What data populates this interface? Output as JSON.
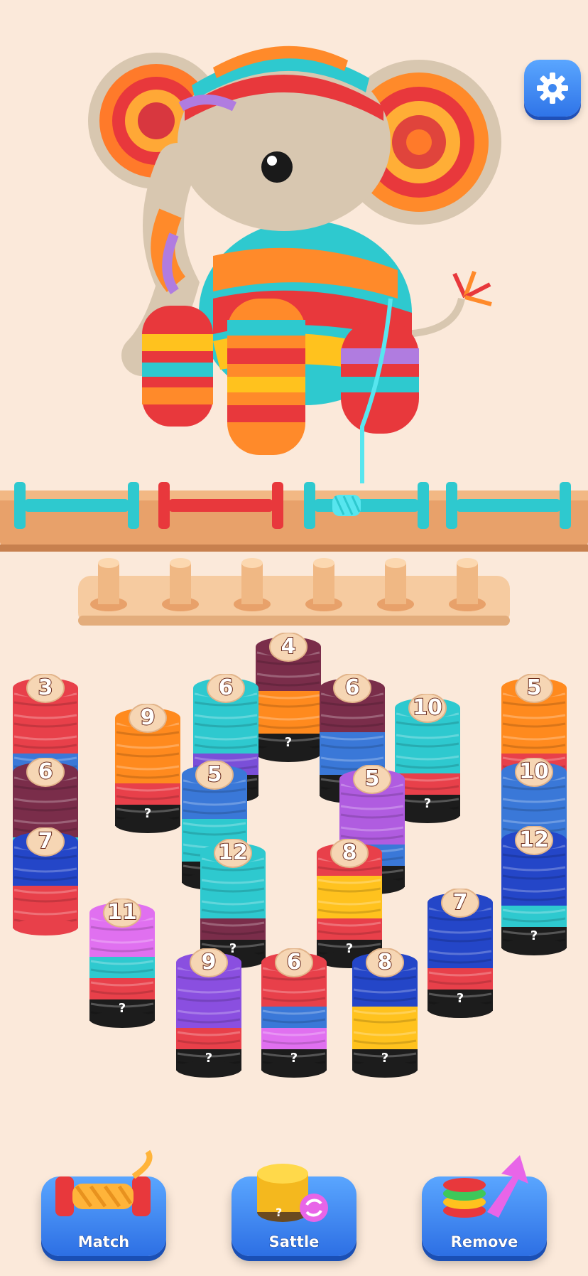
{
  "settings": {
    "icon": "gear-icon"
  },
  "pin_board": {
    "pins": 6
  },
  "spool_racks": [
    {
      "color": "#2ec9cf",
      "state": "empty"
    },
    {
      "color": "#e8383c",
      "state": "empty"
    },
    {
      "color": "#2ec9cf",
      "state": "winding"
    },
    {
      "color": "#2ec9cf",
      "state": "empty"
    }
  ],
  "spools": [
    {
      "count": "4",
      "hidden": "?",
      "layers": [
        "#1c1c1c",
        "#ff8a1e",
        "#ff8a1e",
        "#7a2d4a",
        "#7a2d4a"
      ]
    },
    {
      "count": "3",
      "hidden": "",
      "layers": [
        "#3a78d8",
        "#e8404a",
        "#e8404a",
        "#e8404a"
      ]
    },
    {
      "count": "6",
      "hidden": "?",
      "layers": [
        "#1c1c1c",
        "#7a4fd8",
        "#2ec9cf",
        "#2ec9cf",
        "#2ec9cf"
      ]
    },
    {
      "count": "6",
      "hidden": "?",
      "layers": [
        "#1c1c1c",
        "#3a78d8",
        "#3a78d8",
        "#7a2d4a",
        "#7a2d4a"
      ]
    },
    {
      "count": "10",
      "hidden": "?",
      "layers": [
        "#1c1c1c",
        "#e8404a",
        "#2ec9cf",
        "#2ec9cf",
        "#2ec9cf"
      ]
    },
    {
      "count": "5",
      "hidden": "",
      "layers": [
        "#e8404a",
        "#ff8a1e",
        "#ff8a1e",
        "#ff8a1e"
      ]
    },
    {
      "count": "9",
      "hidden": "?",
      "layers": [
        "#1c1c1c",
        "#e8404a",
        "#ff8a1e",
        "#ff8a1e",
        "#ff8a1e"
      ]
    },
    {
      "count": "6",
      "hidden": "",
      "layers": [
        "#2ec9cf",
        "#7a2d4a",
        "#7a2d4a",
        "#7a2d4a"
      ]
    },
    {
      "count": "5",
      "hidden": "?",
      "layers": [
        "#1c1c1c",
        "#2ec9cf",
        "#2ec9cf",
        "#3a78d8",
        "#3a78d8"
      ]
    },
    {
      "count": "5",
      "hidden": "?",
      "layers": [
        "#1c1c1c",
        "#3a78d8",
        "#b05ce0",
        "#b05ce0",
        "#b05ce0"
      ]
    },
    {
      "count": "10",
      "hidden": "",
      "layers": [
        "#3a78d8",
        "#3a78d8",
        "#3a78d8",
        "#3a78d8"
      ]
    },
    {
      "count": "7",
      "hidden": "",
      "layers": [
        "#e8404a",
        "#e8404a",
        "#2446c8",
        "#2446c8"
      ]
    },
    {
      "count": "12",
      "hidden": "?",
      "layers": [
        "#1c1c1c",
        "#7a2d4a",
        "#2ec9cf",
        "#2ec9cf",
        "#2ec9cf"
      ]
    },
    {
      "count": "8",
      "hidden": "?",
      "layers": [
        "#1c1c1c",
        "#e8404a",
        "#ffc21e",
        "#ffc21e",
        "#e8404a"
      ]
    },
    {
      "count": "12",
      "hidden": "?",
      "layers": [
        "#1c1c1c",
        "#2ec9cf",
        "#2446c8",
        "#2446c8",
        "#2446c8"
      ]
    },
    {
      "count": "7",
      "hidden": "?",
      "layers": [
        "#1c1c1c",
        "#ffc21e",
        "#e8404a",
        "#2446c8",
        "#2446c8"
      ]
    },
    {
      "count": "11",
      "hidden": "?",
      "layers": [
        "#1c1c1c",
        "#e8404a",
        "#2ec9cf",
        "#e070f0",
        "#e070f0"
      ]
    },
    {
      "count": "7",
      "hidden": "?",
      "layers": [
        "#1c1c1c",
        "#e8404a",
        "#2446c8",
        "#2446c8",
        "#2446c8"
      ]
    },
    {
      "count": "9",
      "hidden": "?",
      "layers": [
        "#1c1c1c",
        "#e8404a",
        "#8a4fe0",
        "#8a4fe0",
        "#8a4fe0"
      ]
    },
    {
      "count": "6",
      "hidden": "?",
      "layers": [
        "#1c1c1c",
        "#e070f0",
        "#3a78d8",
        "#e8404a",
        "#e8404a"
      ]
    },
    {
      "count": "8",
      "hidden": "?",
      "layers": [
        "#1c1c1c",
        "#ffc21e",
        "#ffc21e",
        "#2446c8",
        "#2446c8"
      ]
    }
  ],
  "tools": [
    {
      "label": "Match",
      "icon": "thread-spool-icon"
    },
    {
      "label": "Sattle",
      "icon": "coin-stack-shuffle-icon"
    },
    {
      "label": "Remove",
      "icon": "yarn-stack-arrow-icon"
    }
  ]
}
